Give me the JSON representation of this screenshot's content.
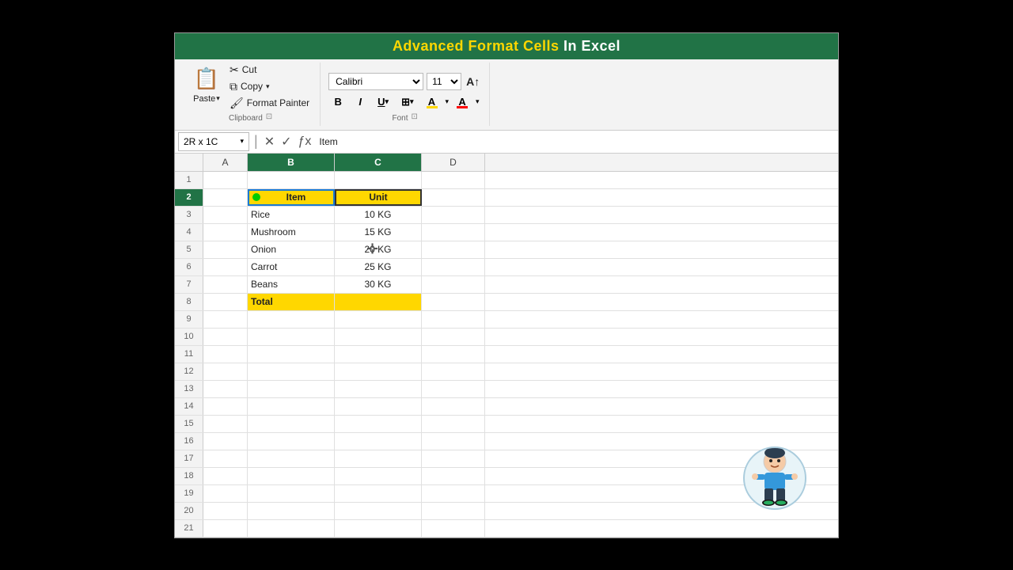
{
  "title": {
    "part1": "Advanced Format Cells",
    "part2": " In Excel"
  },
  "ribbon": {
    "clipboard": {
      "label": "Clipboard",
      "paste_label": "Paste",
      "cut_label": "Cut",
      "copy_label": "Copy",
      "format_painter_label": "Format Painter"
    },
    "font": {
      "label": "Font",
      "font_name": "Calibri",
      "font_size": "11",
      "bold": "B",
      "italic": "I",
      "underline": "U"
    }
  },
  "formula_bar": {
    "name_box": "2R x 1C",
    "formula_value": "Item"
  },
  "columns": [
    "A",
    "B",
    "C",
    "D"
  ],
  "rows": [
    1,
    2,
    3,
    4,
    5,
    6,
    7,
    8,
    9,
    10,
    11,
    12,
    13,
    14,
    15,
    16,
    17,
    18,
    19,
    20,
    21
  ],
  "table": {
    "header_b": "Item",
    "header_c": "Unit",
    "data": [
      {
        "item": "Rice",
        "unit": "10 KG"
      },
      {
        "item": "Mushroom",
        "unit": "15 KG"
      },
      {
        "item": "Onion",
        "unit": "20 KG"
      },
      {
        "item": "Carrot",
        "unit": "25 KG"
      },
      {
        "item": "Beans",
        "unit": "30 KG"
      }
    ],
    "total_label": "Total"
  }
}
